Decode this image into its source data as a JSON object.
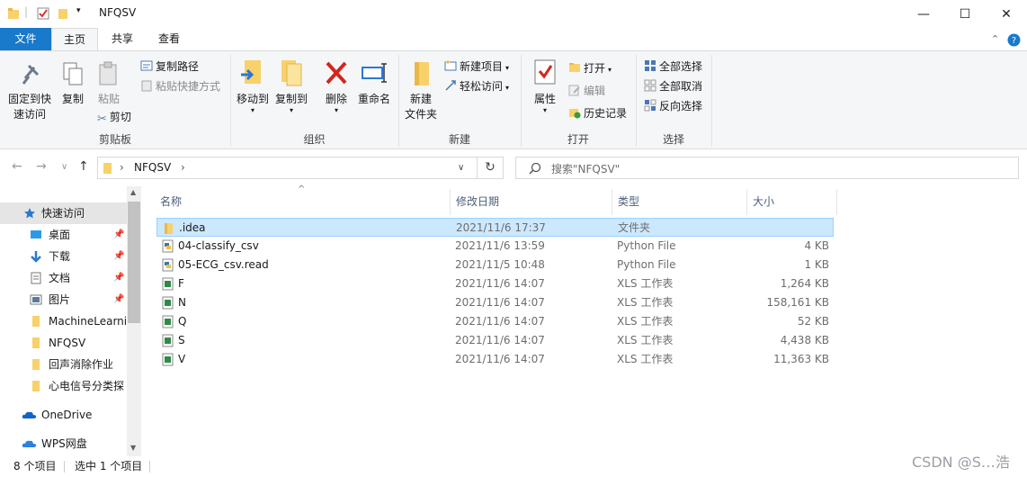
{
  "window": {
    "title": "NFQSV",
    "controls": {
      "minimize": "—",
      "maximize": "☐",
      "close": "✕"
    }
  },
  "ribbon_tabs": [
    {
      "label": "文件"
    },
    {
      "label": "主页"
    },
    {
      "label": "共享"
    },
    {
      "label": "查看"
    }
  ],
  "ribbon": {
    "clipboard": {
      "group_label": "剪贴板",
      "pin_label_1": "固定到快",
      "pin_label_2": "速访问",
      "copy": "复制",
      "paste": "粘贴",
      "copy_path": "复制路径",
      "paste_shortcut": "粘贴快捷方式",
      "cut": "剪切"
    },
    "organize": {
      "group_label": "组织",
      "move_to": "移动到",
      "copy_to": "复制到",
      "delete": "删除",
      "rename": "重命名"
    },
    "new": {
      "group_label": "新建",
      "new_folder_1": "新建",
      "new_folder_2": "文件夹",
      "new_item": "新建项目",
      "easy_access": "轻松访问"
    },
    "open": {
      "group_label": "打开",
      "properties": "属性",
      "open": "打开",
      "edit": "编辑",
      "history": "历史记录"
    },
    "select": {
      "group_label": "选择",
      "select_all": "全部选择",
      "select_none": "全部取消",
      "invert": "反向选择"
    }
  },
  "address": {
    "path": "NFQSV",
    "search_placeholder": "搜索\"NFQSV\""
  },
  "nav_pane": {
    "quick_access": "快速访问",
    "items": [
      {
        "label": "桌面",
        "pinned": true
      },
      {
        "label": "下载",
        "pinned": true
      },
      {
        "label": "文档",
        "pinned": true
      },
      {
        "label": "图片",
        "pinned": true
      },
      {
        "label": "MachineLearni",
        "pinned": false
      },
      {
        "label": "NFQSV",
        "pinned": false
      },
      {
        "label": "回声消除作业",
        "pinned": false
      },
      {
        "label": "心电信号分类探",
        "pinned": false
      }
    ],
    "onedrive": "OneDrive",
    "wps": "WPS网盘"
  },
  "columns": {
    "name": "名称",
    "date": "修改日期",
    "type": "类型",
    "size": "大小"
  },
  "files": [
    {
      "name": ".idea",
      "date": "2021/11/6 17:37",
      "type": "文件夹",
      "size": "",
      "kind": "folder"
    },
    {
      "name": "04-classify_csv",
      "date": "2021/11/6 13:59",
      "type": "Python File",
      "size": "4 KB",
      "kind": "python"
    },
    {
      "name": "05-ECG_csv.read",
      "date": "2021/11/5 10:48",
      "type": "Python File",
      "size": "1 KB",
      "kind": "python"
    },
    {
      "name": "F",
      "date": "2021/11/6 14:07",
      "type": "XLS 工作表",
      "size": "1,264 KB",
      "kind": "xls"
    },
    {
      "name": "N",
      "date": "2021/11/6 14:07",
      "type": "XLS 工作表",
      "size": "158,161 KB",
      "kind": "xls"
    },
    {
      "name": "Q",
      "date": "2021/11/6 14:07",
      "type": "XLS 工作表",
      "size": "52 KB",
      "kind": "xls"
    },
    {
      "name": "S",
      "date": "2021/11/6 14:07",
      "type": "XLS 工作表",
      "size": "4,438 KB",
      "kind": "xls"
    },
    {
      "name": "V",
      "date": "2021/11/6 14:07",
      "type": "XLS 工作表",
      "size": "11,363 KB",
      "kind": "xls"
    }
  ],
  "status": {
    "count": "8 个项目",
    "selected": "选中 1 个项目"
  },
  "watermark": "CSDN @S…浩",
  "colors": {
    "accent": "#1979ca",
    "selection": "#cce8ff",
    "selection_border": "#99d1ff",
    "folder": "#f8d16b"
  }
}
